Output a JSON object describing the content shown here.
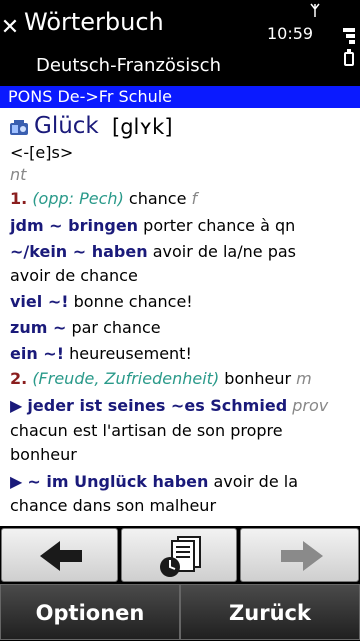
{
  "status": {
    "app_title": "Wörterbuch",
    "subtitle": "Deutsch-Französisch",
    "time": "10:59"
  },
  "dictionary_bar": "PONS De->Fr Schule",
  "entry": {
    "headword": "Glück",
    "pronunciation": "[glʏk]",
    "genitive": "<-[e]s>",
    "gender": "nt",
    "lines": {
      "s1_num": "1.",
      "s1_note": "(opp: Pech)",
      "s1_tr": "chance",
      "s1_g": "f",
      "p1_de": "jdm ~ bringen",
      "p1_fr": "porter chance à qn",
      "p2_de": "~/kein ~ haben",
      "p2_fr": "avoir de la/ne pas",
      "p2_fr2": "avoir de chance",
      "p3_de": "viel ~!",
      "p3_fr": "bonne chance!",
      "p4_de": "zum ~",
      "p4_fr": "par chance",
      "p5_de": "ein ~!",
      "p5_fr": "heureusement!",
      "s2_num": "2.",
      "s2_note": "(Freude, Zufriedenheit)",
      "s2_tr": "bonheur",
      "s2_g": "m",
      "p6_de": "jeder ist seines ~es Schmied",
      "p6_tag": "prov",
      "p6_fr": "chacun est l'artisan de son propre",
      "p6_fr2": "bonheur",
      "p7_de": "~ im Unglück haben",
      "p7_fr": "avoir de la",
      "p7_fr2": "chance dans son malheur"
    }
  },
  "toolbar": {
    "back": "arrow-left-icon",
    "history": "history-icon",
    "forward": "arrow-right-icon"
  },
  "softkeys": {
    "left": "Optionen",
    "right": "Zurück"
  }
}
